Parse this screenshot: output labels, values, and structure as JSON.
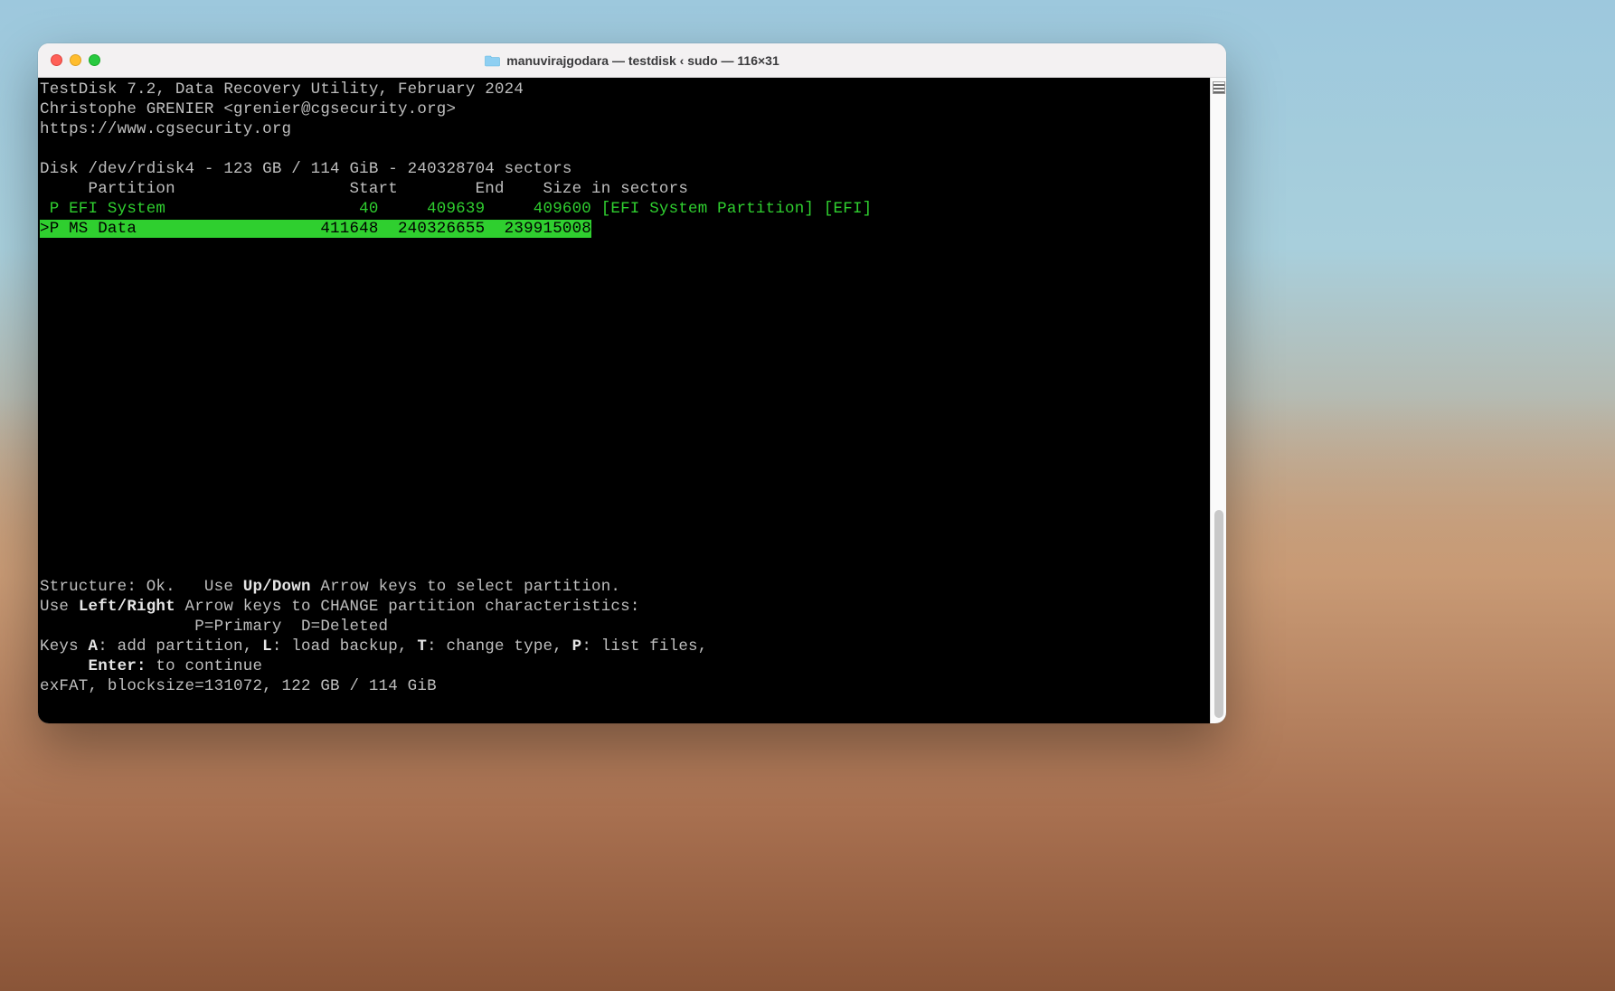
{
  "window": {
    "title": "manuvirajgodara — testdisk ‹ sudo — 116×31"
  },
  "header": {
    "line1": "TestDisk 7.2, Data Recovery Utility, February 2024",
    "line2": "Christophe GRENIER <grenier@cgsecurity.org>",
    "line3": "https://www.cgsecurity.org"
  },
  "disk_line": "Disk /dev/rdisk4 - 123 GB / 114 GiB - 240328704 sectors",
  "columns_line": "     Partition                  Start        End    Size in sectors",
  "partitions": [
    {
      "selected": false,
      "text": " P EFI System                    40     409639     409600 [EFI System Partition] [EFI]"
    },
    {
      "selected": true,
      "text": ">P MS Data                   411648  240326655  239915008"
    }
  ],
  "footer": {
    "structure_prefix": "Structure: Ok.   Use ",
    "updown": "Up/Down",
    "structure_suffix": " Arrow keys to select partition.",
    "leftright_prefix": "Use ",
    "leftright": "Left/Right",
    "leftright_suffix": " Arrow keys to CHANGE partition characteristics:",
    "legend_line": "                P=Primary  D=Deleted",
    "keys_prefix": "Keys ",
    "key_a": "A",
    "key_a_text": ": add partition, ",
    "key_l": "L",
    "key_l_text": ": load backup, ",
    "key_t": "T",
    "key_t_text": ": change type, ",
    "key_p": "P",
    "key_p_text": ": list files,",
    "enter_prefix": "     ",
    "enter": "Enter:",
    "enter_text": " to continue",
    "fs_line": "exFAT, blocksize=131072, 122 GB / 114 GiB"
  }
}
